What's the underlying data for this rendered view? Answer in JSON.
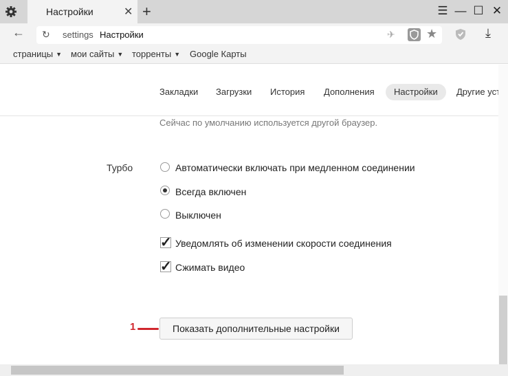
{
  "tab": {
    "title": "Настройки",
    "close": "✕",
    "new_tab": "+"
  },
  "window_controls": {
    "menu": "☰",
    "minimize": "—",
    "maximize": "☐",
    "close": "✕"
  },
  "toolbar": {
    "back": "←",
    "reload": "↻",
    "url_scheme": "settings",
    "url_title": "Настройки",
    "download": "⤓",
    "star": "★",
    "rocket": "✈"
  },
  "bookmarks": [
    {
      "label": "страницы",
      "dropdown": true
    },
    {
      "label": "мои сайты",
      "dropdown": true
    },
    {
      "label": "торренты",
      "dropdown": true
    },
    {
      "label": "Google Карты",
      "dropdown": false
    }
  ],
  "settings_nav": [
    "Закладки",
    "Загрузки",
    "История",
    "Дополнения",
    "Настройки",
    "Другие устро"
  ],
  "settings_nav_active": "Настройки",
  "default_browser_note": "Сейчас по умолчанию используется другой браузер.",
  "turbo": {
    "label": "Турбо",
    "options": [
      {
        "label": "Автоматически включать при медленном соединении",
        "selected": false
      },
      {
        "label": "Всегда включен",
        "selected": true
      },
      {
        "label": "Выключен",
        "selected": false
      }
    ],
    "checkboxes": [
      {
        "label": "Уведомлять об изменении скорости соединения",
        "checked": true
      },
      {
        "label": "Сжимать видео",
        "checked": true
      }
    ]
  },
  "show_more_button": "Показать дополнительные настройки",
  "annotation": {
    "number": "1",
    "color": "#d0262d"
  }
}
